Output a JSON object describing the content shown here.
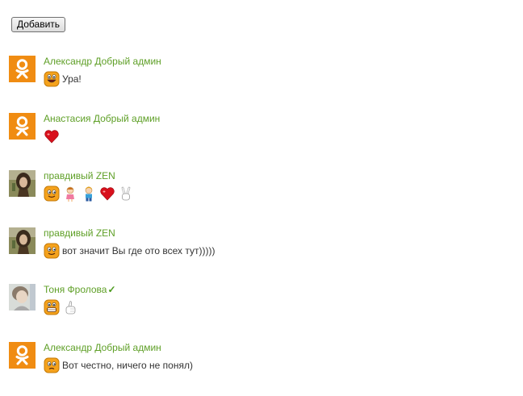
{
  "add_button_label": "Добавить",
  "comments": [
    {
      "author": "Александр Добрый админ",
      "verified_mark": "",
      "avatar": "ok-logo-icon",
      "emojis": [
        "laughing-smiley-icon"
      ],
      "text": "Ура!"
    },
    {
      "author": "Анастасия Добрый админ",
      "verified_mark": "",
      "avatar": "ok-logo-icon",
      "emojis": [
        "red-heart-icon"
      ],
      "text": ""
    },
    {
      "author": "правдивый ZEN",
      "verified_mark": "",
      "avatar": "user-photo-icon",
      "emojis": [
        "winking-smiley-icon",
        "girl-icon",
        "boy-icon",
        "red-heart-icon",
        "victory-hand-icon"
      ],
      "text": ""
    },
    {
      "author": "правдивый ZEN",
      "verified_mark": "",
      "avatar": "user-photo-icon",
      "emojis": [
        "winking-smiley-icon"
      ],
      "text": "вот значит Вы где ото всех тут)))))"
    },
    {
      "author": "Тоня Фролова",
      "verified_mark": "✓",
      "avatar": "user-photo-light-icon",
      "emojis": [
        "grinning-smiley-icon",
        "thumbs-up-icon"
      ],
      "text": ""
    },
    {
      "author": "Александр Добрый админ",
      "verified_mark": "",
      "avatar": "ok-logo-icon",
      "emojis": [
        "confused-smiley-icon"
      ],
      "text": "Вот честно, ничего не понял)"
    }
  ],
  "colors": {
    "author_link": "#5e9f26",
    "ok_orange": "#f08c12",
    "heart_red": "#d8101c",
    "smiley_orange": "#f5a21c"
  }
}
